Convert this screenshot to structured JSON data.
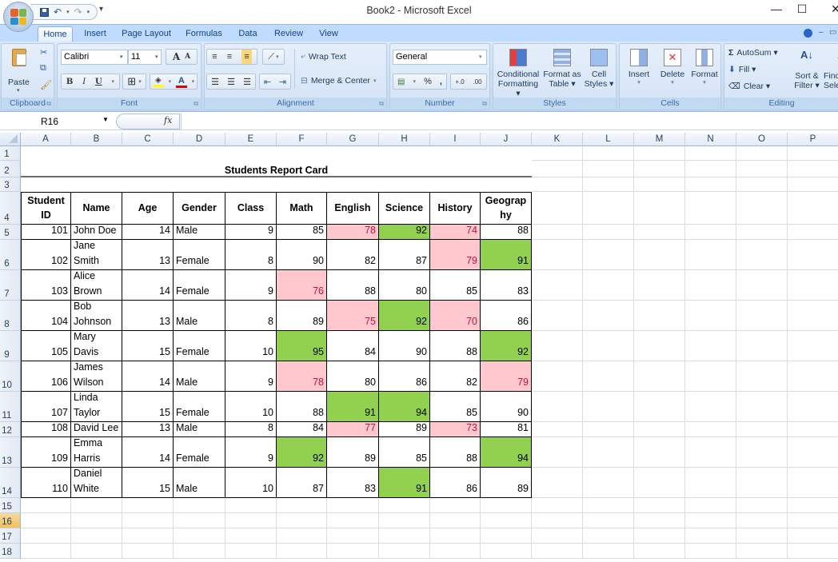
{
  "window": {
    "title": "Book2 - Microsoft Excel",
    "controls": {
      "minimize": "—",
      "maximize": "☐",
      "close": "✕"
    }
  },
  "quick_access": {
    "save_icon": "save-icon",
    "undo_icon": "undo-icon",
    "redo_icon": "redo-icon",
    "customize": "▾"
  },
  "tabs": [
    {
      "label": "Home",
      "active": true
    },
    {
      "label": "Insert"
    },
    {
      "label": "Page Layout"
    },
    {
      "label": "Formulas"
    },
    {
      "label": "Data"
    },
    {
      "label": "Review"
    },
    {
      "label": "View"
    }
  ],
  "ribbon": {
    "clipboard": {
      "label": "Clipboard",
      "paste": "Paste"
    },
    "font": {
      "label": "Font",
      "name": "Calibri",
      "size": "11",
      "bold": "B",
      "italic": "I",
      "underline": "U",
      "grow": "A",
      "shrink": "A"
    },
    "alignment": {
      "label": "Alignment",
      "wrap_text": "Wrap Text",
      "merge_center": "Merge & Center"
    },
    "number": {
      "label": "Number",
      "format": "General",
      "percent": "%",
      "comma": ",",
      "inc_decimal": "+.0",
      "dec_decimal": ".00"
    },
    "styles": {
      "label": "Styles",
      "conditional": [
        "Conditional",
        "Formatting ▾"
      ],
      "format_table": [
        "Format as",
        "Table ▾"
      ],
      "cell_styles": [
        "Cell",
        "Styles ▾"
      ]
    },
    "cells": {
      "label": "Cells",
      "insert": "Insert",
      "delete": "Delete",
      "format": "Format"
    },
    "editing": {
      "label": "Editing",
      "autosum": "AutoSum ▾",
      "fill": "Fill ▾",
      "clear": "Clear ▾",
      "sort": [
        "Sort &",
        "Filter ▾"
      ],
      "find": [
        "Find &",
        "Select ▾"
      ]
    }
  },
  "formula_bar": {
    "name_box": "R16",
    "fx": "fx",
    "value": ""
  },
  "columns": [
    "A",
    "B",
    "C",
    "D",
    "E",
    "F",
    "G",
    "H",
    "I",
    "J",
    "K",
    "L",
    "M",
    "N",
    "O",
    "P"
  ],
  "rows": [
    "1",
    "2",
    "3",
    "4",
    "5",
    "6",
    "7",
    "8",
    "9",
    "10",
    "11",
    "12",
    "13",
    "14",
    "15",
    "16",
    "17",
    "18"
  ],
  "selected_row": "16",
  "sheet": {
    "title": "Students Report Card",
    "headers": [
      [
        "Student",
        "ID"
      ],
      [
        "Name"
      ],
      [
        "Age"
      ],
      [
        "Gender"
      ],
      [
        "Class"
      ],
      [
        "Math"
      ],
      [
        "English"
      ],
      [
        "Science"
      ],
      [
        "History"
      ],
      [
        "Geograp",
        "hy"
      ]
    ],
    "students": [
      {
        "id": "101",
        "name": [
          "John Doe"
        ],
        "age": "14",
        "gender": "Male",
        "class": "9",
        "scores": [
          "85",
          "78",
          "92",
          "74",
          "88"
        ],
        "flags": [
          "",
          "low",
          "high",
          "low",
          ""
        ]
      },
      {
        "id": "102",
        "name": [
          "Jane",
          "Smith"
        ],
        "age": "13",
        "gender": "Female",
        "class": "8",
        "scores": [
          "90",
          "82",
          "87",
          "79",
          "91"
        ],
        "flags": [
          "",
          "",
          "",
          "low",
          "high"
        ]
      },
      {
        "id": "103",
        "name": [
          "Alice",
          "Brown"
        ],
        "age": "14",
        "gender": "Female",
        "class": "9",
        "scores": [
          "76",
          "88",
          "80",
          "85",
          "83"
        ],
        "flags": [
          "low",
          "",
          "",
          "",
          ""
        ]
      },
      {
        "id": "104",
        "name": [
          "Bob",
          "Johnson"
        ],
        "age": "13",
        "gender": "Male",
        "class": "8",
        "scores": [
          "89",
          "75",
          "92",
          "70",
          "86"
        ],
        "flags": [
          "",
          "low",
          "high",
          "low",
          ""
        ]
      },
      {
        "id": "105",
        "name": [
          "Mary",
          "Davis"
        ],
        "age": "15",
        "gender": "Female",
        "class": "10",
        "scores": [
          "95",
          "84",
          "90",
          "88",
          "92"
        ],
        "flags": [
          "high",
          "",
          "",
          "",
          "high"
        ]
      },
      {
        "id": "106",
        "name": [
          "James",
          "Wilson"
        ],
        "age": "14",
        "gender": "Male",
        "class": "9",
        "scores": [
          "78",
          "80",
          "86",
          "82",
          "79"
        ],
        "flags": [
          "low",
          "",
          "",
          "",
          "low"
        ]
      },
      {
        "id": "107",
        "name": [
          "Linda",
          "Taylor"
        ],
        "age": "15",
        "gender": "Female",
        "class": "10",
        "scores": [
          "88",
          "91",
          "94",
          "85",
          "90"
        ],
        "flags": [
          "",
          "high",
          "high",
          "",
          ""
        ]
      },
      {
        "id": "108",
        "name": [
          "David Lee"
        ],
        "age": "13",
        "gender": "Male",
        "class": "8",
        "scores": [
          "84",
          "77",
          "89",
          "73",
          "81"
        ],
        "flags": [
          "",
          "low",
          "",
          "low",
          ""
        ]
      },
      {
        "id": "109",
        "name": [
          "Emma",
          "Harris"
        ],
        "age": "14",
        "gender": "Female",
        "class": "9",
        "scores": [
          "92",
          "89",
          "85",
          "88",
          "94"
        ],
        "flags": [
          "high",
          "",
          "",
          "",
          "high"
        ]
      },
      {
        "id": "110",
        "name": [
          "Daniel",
          "White"
        ],
        "age": "15",
        "gender": "Male",
        "class": "10",
        "scores": [
          "87",
          "83",
          "91",
          "86",
          "89"
        ],
        "flags": [
          "",
          "",
          "high",
          "",
          ""
        ]
      }
    ]
  },
  "colors": {
    "low_fill": "#ffc7ce",
    "low_text": "#c0143c",
    "high_fill": "#92d050",
    "ribbon_tab": "#bfdbff"
  }
}
